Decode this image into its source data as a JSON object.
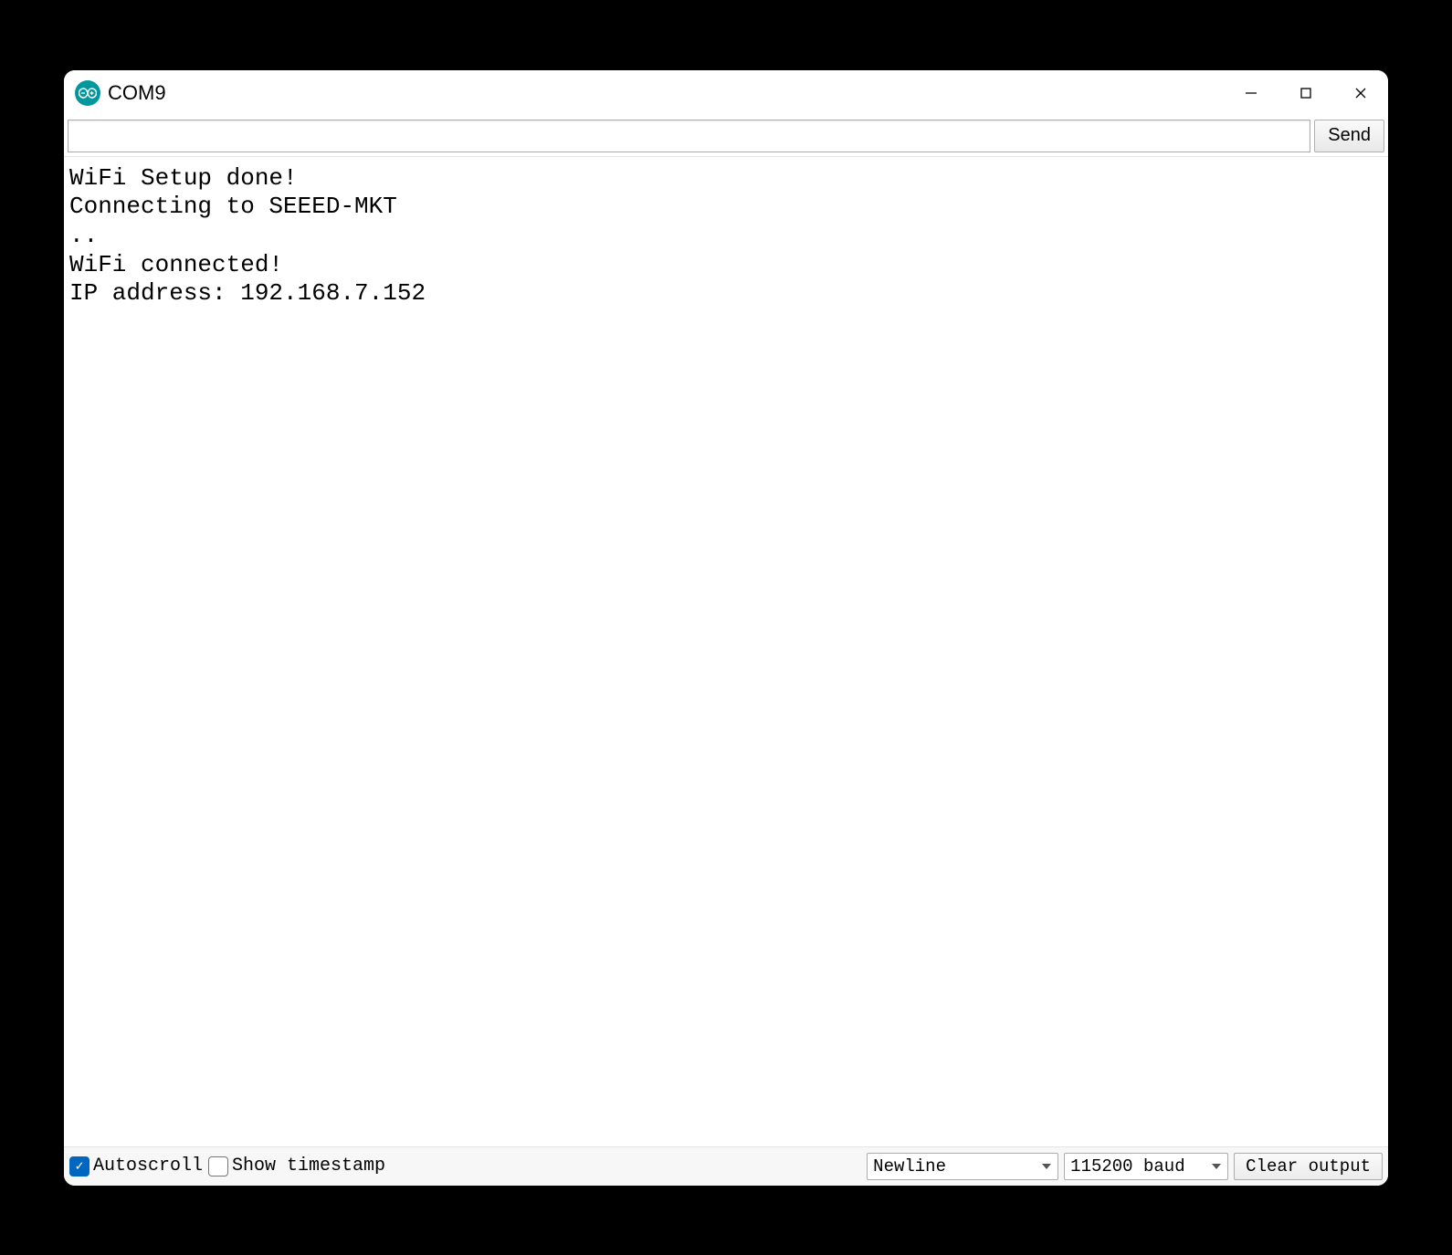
{
  "window": {
    "title": "COM9"
  },
  "toolbar": {
    "input_value": "",
    "send_label": "Send"
  },
  "console": {
    "lines": [
      "WiFi Setup done!",
      "Connecting to SEEED-MKT",
      "..",
      "WiFi connected!",
      "IP address: 192.168.7.152"
    ]
  },
  "status": {
    "autoscroll": {
      "label": "Autoscroll",
      "checked": true
    },
    "show_ts": {
      "label": "Show timestamp",
      "checked": false
    },
    "line_ending": "Newline",
    "baud": "115200 baud",
    "clear_label": "Clear output"
  }
}
